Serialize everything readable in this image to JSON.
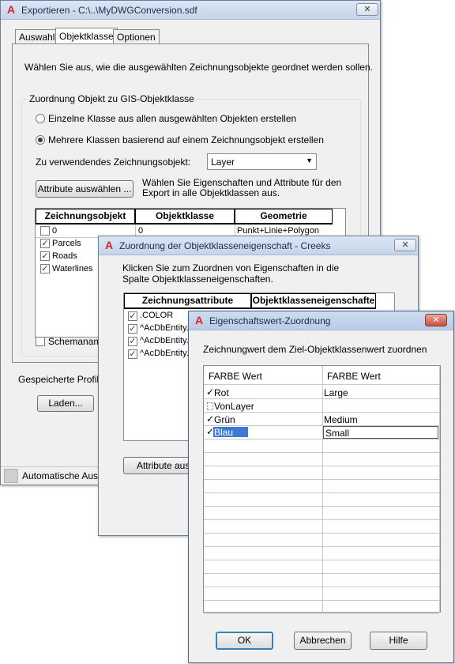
{
  "win1": {
    "title": "Exportieren - C:\\..\\MyDWGConversion.sdf",
    "tabs": [
      "Auswahl",
      "Objektklasse",
      "Optionen"
    ],
    "intro": "Wählen Sie aus, wie die ausgewählten Zeichnungsobjekte geordnet werden sollen.",
    "group_title": "Zuordnung Objekt zu GIS-Objektklasse",
    "radio1": "Einzelne Klasse aus allen ausgewählten Objekten erstellen",
    "radio2": "Mehrere Klassen basierend auf einem Zeichnungsobjekt erstellen",
    "object_label": "Zu verwendendes Zeichnungsobjekt:",
    "object_value": "Layer",
    "attr_button": "Attribute auswählen ...",
    "attr_hint": "Wählen Sie Eigenschaften und Attribute für den Export in alle Objektklassen aus.",
    "table": {
      "headers": [
        "Zeichnungsobjekt",
        "Objektklasse",
        "Geometrie"
      ],
      "rows": [
        {
          "obj": "0",
          "cls": "0",
          "geo": "Punkt+Linie+Polygon"
        },
        {
          "obj": "Parcels",
          "cls": "",
          "geo": ""
        },
        {
          "obj": "Roads",
          "cls": "",
          "geo": ""
        },
        {
          "obj": "Waterlines",
          "cls": "",
          "geo": ""
        }
      ]
    },
    "schema_label": "Schemaname",
    "saved_profiles": "Gespeicherte Profile",
    "load_button": "Laden...",
    "status": "Automatische Aus"
  },
  "win2": {
    "title": "Zuordnung der Objektklasseneigenschaft - Creeks",
    "intro": "Klicken Sie zum Zuordnen von Eigenschaften in die Spalte Objektklasseneigenschaften.",
    "headers": [
      "Zeichnungsattribute",
      "Objektklasseneigenschafte"
    ],
    "rows": [
      ".COLOR",
      "^AcDbEntity.",
      "^AcDbEntity.",
      "^AcDbEntity."
    ],
    "attr_button": "Attribute ausw"
  },
  "win3": {
    "title": "Eigenschaftswert-Zuordnung",
    "intro": "Zeichnungwert dem Ziel-Objektklassenwert zuordnen",
    "headers": [
      "FARBE Wert",
      "FARBE Wert"
    ],
    "rows": [
      {
        "checked": true,
        "src": "Rot",
        "dst": "Large"
      },
      {
        "checked": false,
        "src": "VonLayer",
        "dst": ""
      },
      {
        "checked": true,
        "src": "Grün",
        "dst": "Medium"
      },
      {
        "checked": true,
        "src": "Blau",
        "dst": "Small"
      }
    ],
    "ok": "OK",
    "cancel": "Abbrechen",
    "help": "Hilfe"
  }
}
